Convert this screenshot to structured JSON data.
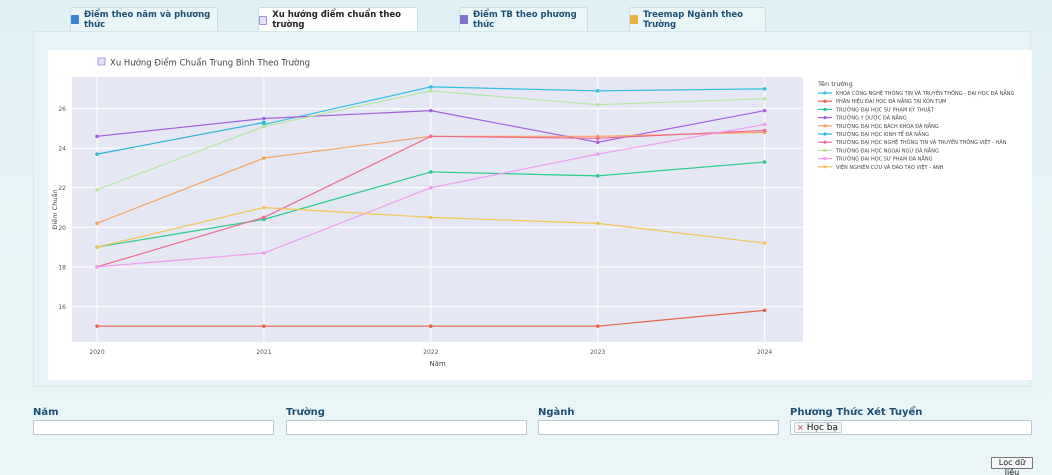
{
  "tabs": [
    {
      "label": "Điểm theo năm và phương thức",
      "icon": "bar-chart-icon",
      "color": "#3b82d6"
    },
    {
      "label": "Xu hướng điểm chuẩn theo trường",
      "icon": "line-chart-icon",
      "color": "#9b8fd6"
    },
    {
      "label": "Điểm TB theo phương thức",
      "icon": "stats-icon",
      "color": "#7f72c9"
    },
    {
      "label": "Treemap Ngành theo Trường",
      "icon": "treemap-icon",
      "color": "#e8b33a"
    }
  ],
  "active_tab": 1,
  "filters": [
    {
      "label": "Năm",
      "value": ""
    },
    {
      "label": "Trường",
      "value": ""
    },
    {
      "label": "Ngành",
      "value": ""
    },
    {
      "label": "Phương Thức Xét Tuyển",
      "value": "",
      "chips": [
        "Học bạ"
      ]
    }
  ],
  "filter_button": "Lọc dữ liệu",
  "chart_data": {
    "type": "line",
    "title": "Xu Hướng Điểm Chuẩn Trung Bình Theo Trường",
    "xlabel": "Năm",
    "ylabel": "Điểm Chuẩn",
    "x": [
      2020,
      2021,
      2022,
      2023,
      2024
    ],
    "xticks": [
      "2020",
      "2021",
      "2022",
      "2023",
      "2024"
    ],
    "yticks": [
      16,
      18,
      20,
      22,
      24,
      26
    ],
    "ylim": [
      14.2,
      27.6
    ],
    "grid": true,
    "legend_title": "Tên trường",
    "legend_position": "right",
    "series": [
      {
        "name": "KHOA CÔNG NGHỆ THÔNG TIN VÀ TRUYỀN THÔNG - ĐẠI HỌC ĐÀ NẴNG",
        "color": "#36c0e0",
        "values": [
          null,
          25.2,
          27.1,
          26.9,
          27.0
        ]
      },
      {
        "name": "PHÂN HIỆU ĐẠI HỌC ĐÀ NẴNG TẠI KON TUM",
        "color": "#e8634a",
        "values": [
          15.0,
          15.0,
          15.0,
          15.0,
          15.8
        ]
      },
      {
        "name": "TRƯỜNG ĐẠI HỌC SƯ PHẠM KỸ THUẬT",
        "color": "#2ccb8e",
        "values": [
          19.0,
          20.4,
          22.8,
          22.6,
          23.3
        ]
      },
      {
        "name": "TRƯỜNG Y DƯỢC ĐÀ NẴNG",
        "color": "#a25fe0",
        "values": [
          24.6,
          25.5,
          25.9,
          24.3,
          25.9
        ]
      },
      {
        "name": "TRƯỜNG ĐẠI HỌC BÁCH KHOA ĐÀ NẴNG",
        "color": "#f5a25e",
        "values": [
          20.2,
          23.5,
          24.6,
          24.6,
          24.8
        ]
      },
      {
        "name": "TRƯỜNG ĐẠI HỌC KINH TẾ ĐÀ NẴNG",
        "color": "#26b6d2",
        "values": [
          23.7,
          25.3,
          null,
          null,
          null
        ]
      },
      {
        "name": "TRƯỜNG ĐẠI HỌC NGHỆ THÔNG TIN VÀ TRUYỀN THÔNG VIỆT - HÀN",
        "color": "#f06a8f",
        "values": [
          18.0,
          20.5,
          24.6,
          24.5,
          24.9
        ]
      },
      {
        "name": "TRƯỜNG ĐẠI HỌC NGOẠI NGỮ ĐÀ NẴNG",
        "color": "#b5e6a0",
        "values": [
          21.9,
          25.1,
          26.9,
          26.2,
          26.5
        ]
      },
      {
        "name": "TRƯỜNG ĐẠI HỌC SƯ PHẠM ĐÀ NẴNG",
        "color": "#f19cf0",
        "values": [
          18.0,
          18.7,
          22.0,
          23.7,
          25.2
        ]
      },
      {
        "name": "VIỆN NGHIÊN CỨU VÀ ĐÀO TẠO VIỆT - ANH",
        "color": "#f5c355",
        "values": [
          19.0,
          21.0,
          20.5,
          20.2,
          19.2
        ]
      }
    ]
  }
}
